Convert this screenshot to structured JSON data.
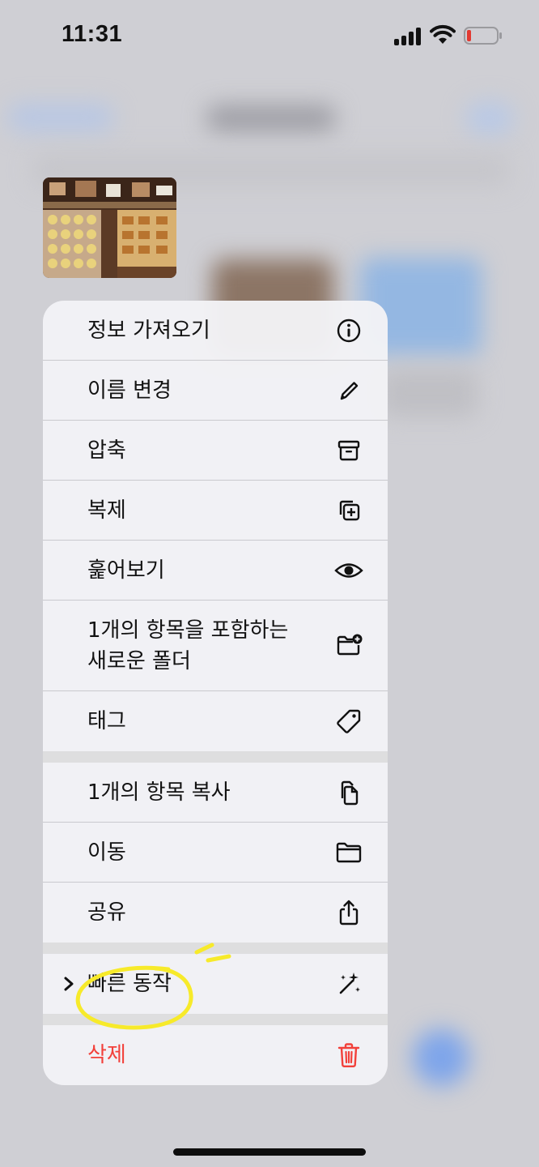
{
  "status_bar": {
    "time": "11:31",
    "battery_color": "#e23a32"
  },
  "menu": {
    "group1": [
      {
        "label": "정보 가져오기",
        "icon": "info-icon"
      },
      {
        "label": "이름 변경",
        "icon": "pencil-icon"
      },
      {
        "label": "압축",
        "icon": "archive-icon"
      },
      {
        "label": "복제",
        "icon": "duplicate-icon"
      },
      {
        "label": "훑어보기",
        "icon": "eye-icon"
      },
      {
        "label": "1개의 항목을 포함하는\n새로운 폴더",
        "icon": "folder-plus-icon"
      },
      {
        "label": "태그",
        "icon": "tag-icon"
      }
    ],
    "group2": [
      {
        "label": "1개의 항목 복사",
        "icon": "copy-docs-icon"
      },
      {
        "label": "이동",
        "icon": "folder-icon"
      },
      {
        "label": "공유",
        "icon": "share-icon"
      }
    ],
    "quick_actions": {
      "label": "빠른 동작",
      "icon": "sparkles-icon"
    },
    "delete": {
      "label": "삭제",
      "icon": "trash-icon"
    }
  },
  "colors": {
    "destructive": "#f2403a",
    "annotation": "#f7ea2a"
  }
}
